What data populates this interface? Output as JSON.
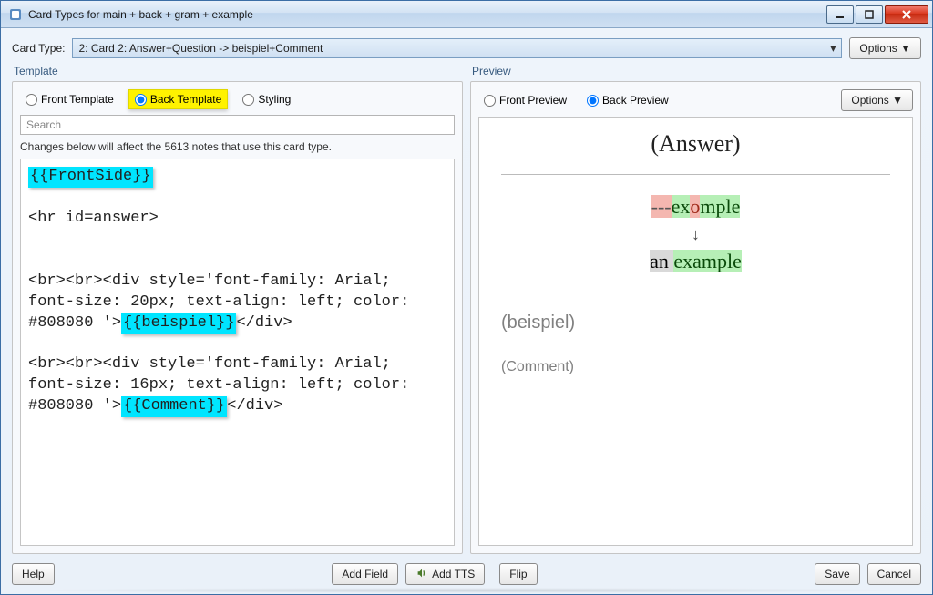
{
  "window": {
    "title": "Card Types for main + back + gram + example"
  },
  "toprow": {
    "label": "Card Type:",
    "selected": "2: Card 2: Answer+Question -> beispiel+Comment",
    "options_button": "Options ▼"
  },
  "template": {
    "header": "Template",
    "radios": {
      "front": "Front Template",
      "back": "Back Template",
      "styling": "Styling",
      "selected": "back"
    },
    "search_placeholder": "Search",
    "hint": "Changes below will affect the 5613 notes that use this card type.",
    "code": {
      "l1_hl": "{{FrontSide}}",
      "l2": "",
      "l3": "<hr id=answer>",
      "l4": "",
      "l5": "",
      "l6": "<br><br><div style='font-family: Arial; font-size: 20px; text-align: left; color: #808080 '>",
      "l6_hl": "{{beispiel}}",
      "l6_tail": "</div>",
      "l7": "",
      "l8": "<br><br><div style='font-family: Arial; font-size: 16px; text-align: left; color: #808080 '>",
      "l8_hl": "{{Comment}}",
      "l8_tail": "</div>"
    }
  },
  "preview": {
    "header": "Preview",
    "radios": {
      "front": "Front Preview",
      "back": "Back Preview",
      "selected": "back"
    },
    "options_button": "Options ▼",
    "answer_label": "(Answer)",
    "diff": {
      "wrong_prefix": "---",
      "wrong_word_pre": "ex",
      "wrong_letter": "o",
      "wrong_word_post": "mple",
      "arrow": "↓",
      "correct_pre_gray": "an ",
      "correct_word": "example"
    },
    "beispiel_label": "(beispiel)",
    "comment_label": "(Comment)"
  },
  "buttons": {
    "help": "Help",
    "add_field": "Add Field",
    "add_tts": "Add TTS",
    "flip": "Flip",
    "save": "Save",
    "cancel": "Cancel"
  }
}
